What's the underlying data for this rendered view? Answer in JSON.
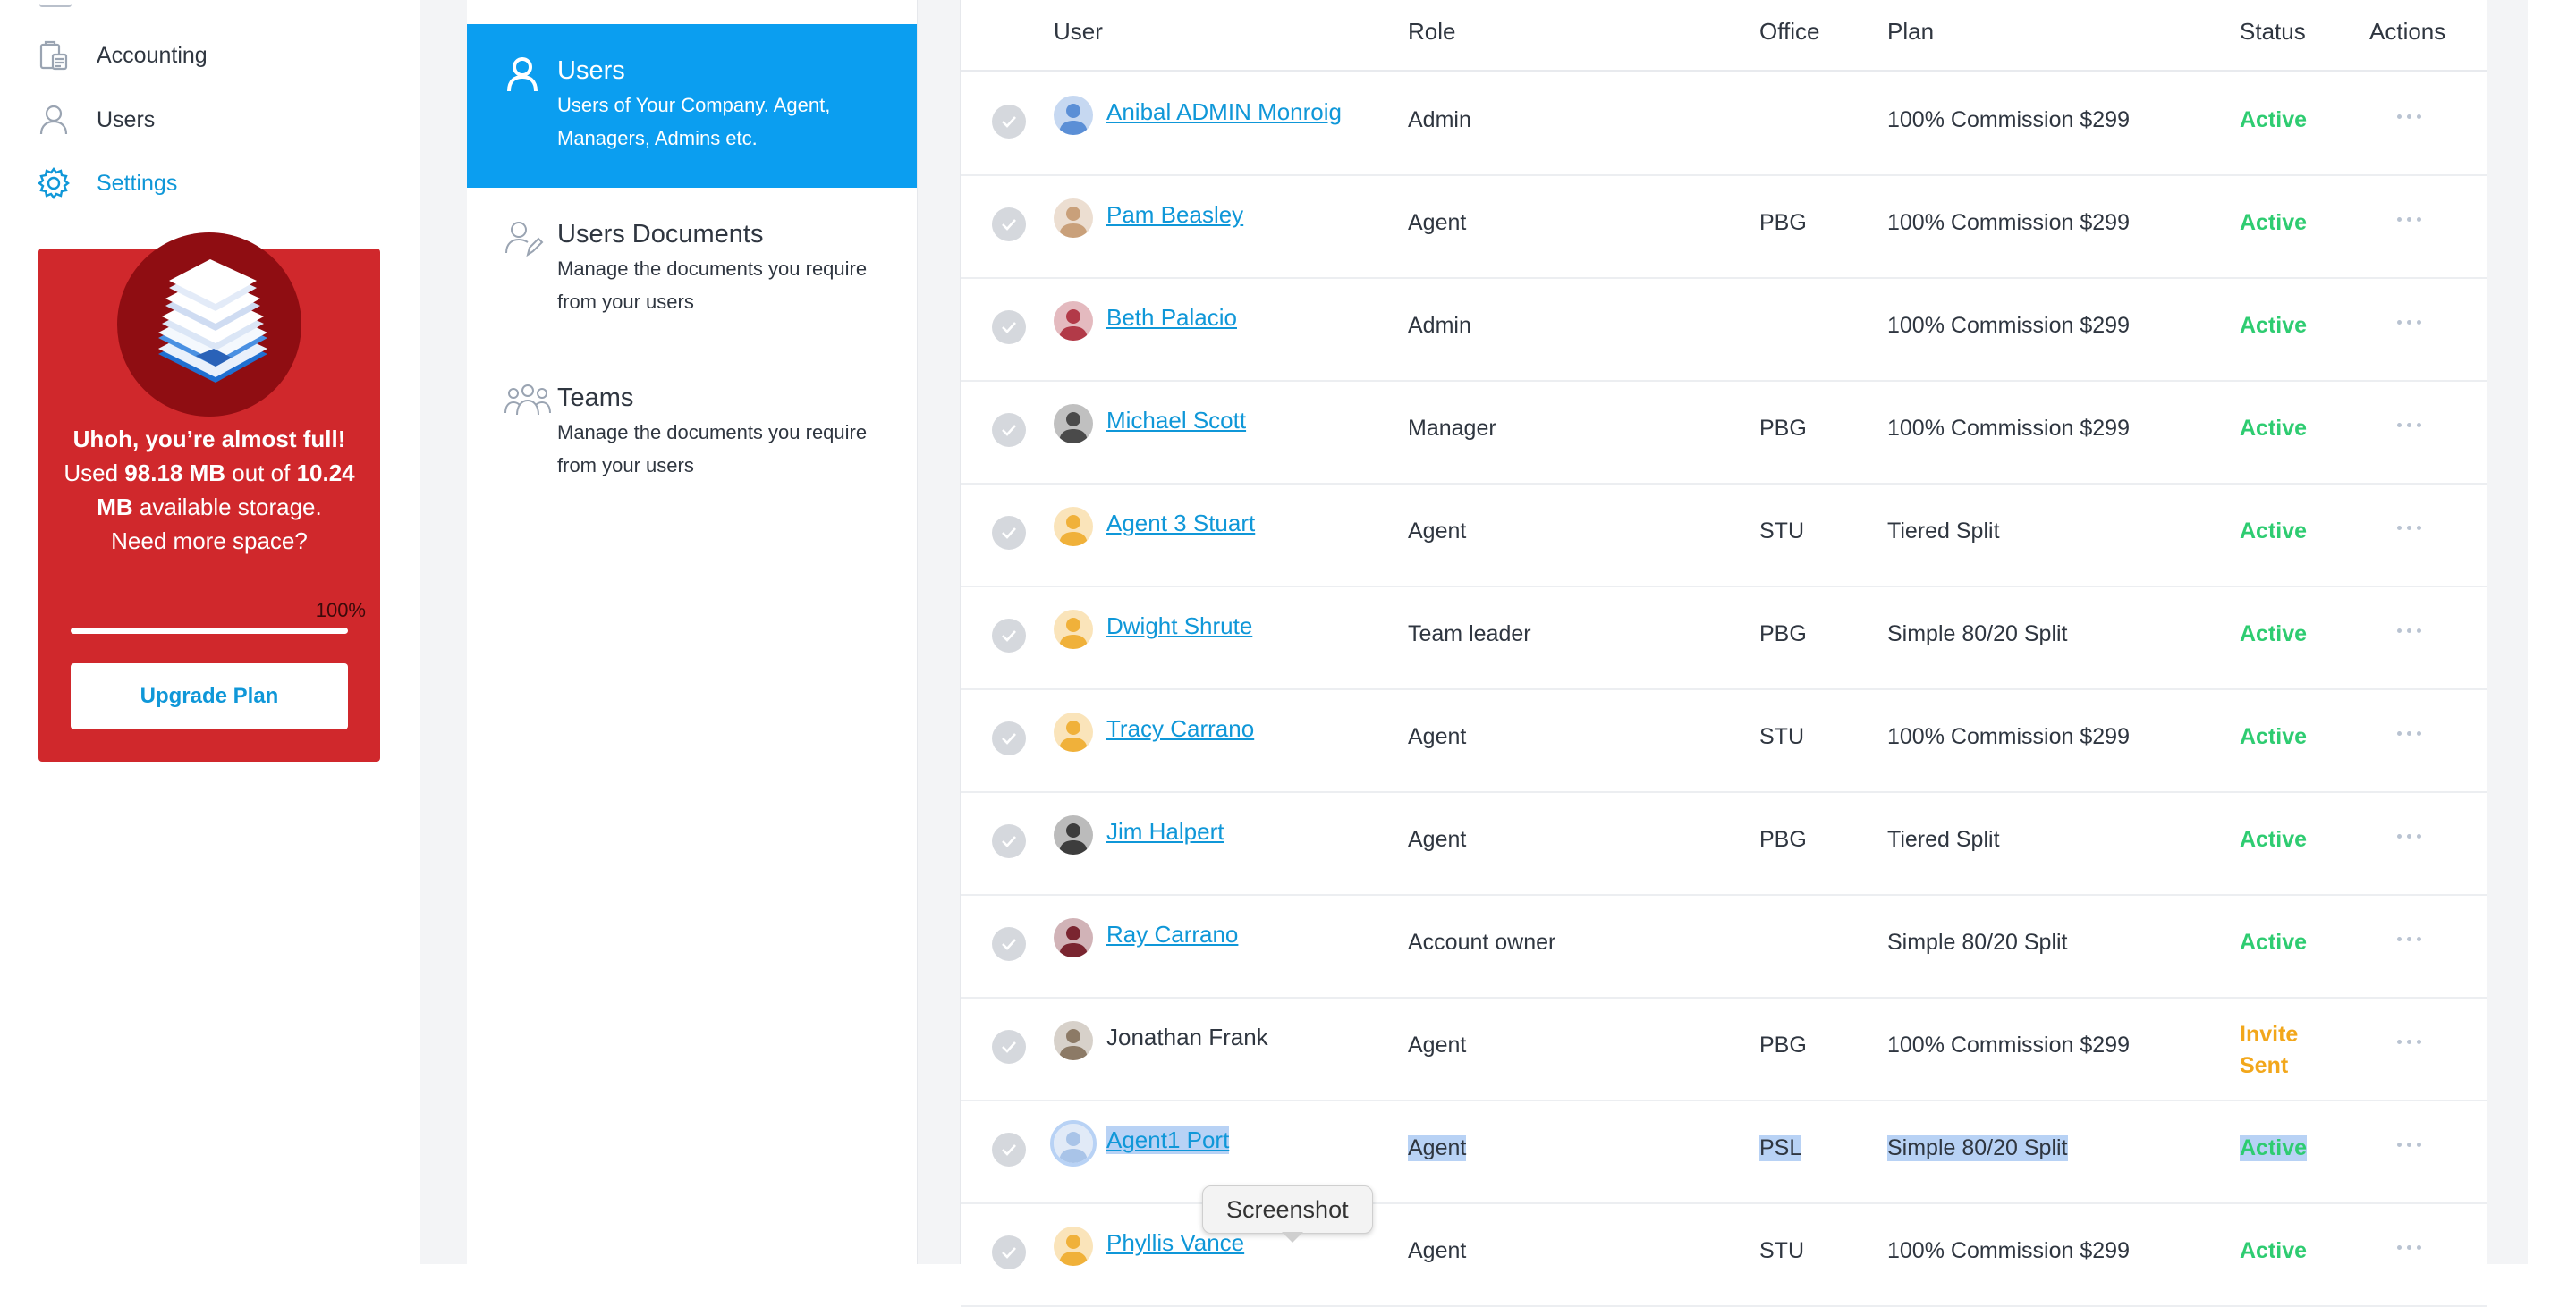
{
  "sidebar": {
    "items": [
      {
        "label": "Accounting",
        "icon": "accounting-icon",
        "active": false
      },
      {
        "label": "Users",
        "icon": "user-icon",
        "active": false
      },
      {
        "label": "Settings",
        "icon": "gear-icon",
        "active": true
      }
    ],
    "storage": {
      "headline": "Uhoh, you’re almost full!",
      "used_prefix": "Used",
      "used_value": "98.18 MB",
      "used_mid": "out of",
      "limit_value": "10.24 MB",
      "limit_suffix": "available storage.",
      "question": "Need more space?",
      "percent_label": "100%",
      "percent_value": 100,
      "button_label": "Upgrade Plan"
    }
  },
  "settings_menu": [
    {
      "title": "Users",
      "description": "Users of Your Company. Agent, Managers, Admins etc.",
      "icon": "user-icon",
      "active": true
    },
    {
      "title": "Users Documents",
      "description": "Manage the documents you require from your users",
      "icon": "user-document-icon",
      "active": false
    },
    {
      "title": "Teams",
      "description": "Manage the documents you require from your users",
      "icon": "team-icon",
      "active": false
    }
  ],
  "table": {
    "headers": {
      "user": "User",
      "role": "Role",
      "office": "Office",
      "plan": "Plan",
      "status": "Status",
      "actions": "Actions"
    },
    "rows": [
      {
        "name": "Anibal ADMIN Monroig",
        "role": "Admin",
        "office": "",
        "plan": "100% Commission $299",
        "status": "Active",
        "linked": true
      },
      {
        "name": "Pam Beasley",
        "role": "Agent",
        "office": "PBG",
        "plan": "100% Commission $299",
        "status": "Active",
        "linked": true
      },
      {
        "name": "Beth Palacio",
        "role": "Admin",
        "office": "",
        "plan": "100% Commission $299",
        "status": "Active",
        "linked": true
      },
      {
        "name": "Michael Scott",
        "role": "Manager",
        "office": "PBG",
        "plan": "100% Commission $299",
        "status": "Active",
        "linked": true
      },
      {
        "name": "Agent 3 Stuart",
        "role": "Agent",
        "office": "STU",
        "plan": "Tiered Split",
        "status": "Active",
        "linked": true
      },
      {
        "name": "Dwight Shrute",
        "role": "Team leader",
        "office": "PBG",
        "plan": "Simple 80/20 Split",
        "status": "Active",
        "linked": true
      },
      {
        "name": "Tracy Carrano",
        "role": "Agent",
        "office": "STU",
        "plan": "100% Commission $299",
        "status": "Active",
        "linked": true
      },
      {
        "name": "Jim Halpert",
        "role": "Agent",
        "office": "PBG",
        "plan": "Tiered Split",
        "status": "Active",
        "linked": true
      },
      {
        "name": "Ray Carrano",
        "role": "Account owner",
        "office": "",
        "plan": "Simple 80/20 Split",
        "status": "Active",
        "linked": true
      },
      {
        "name": "Jonathan Frank",
        "role": "Agent",
        "office": "PBG",
        "plan": "100% Commission $299",
        "status": "Invite Sent",
        "linked": false
      },
      {
        "name": "Agent1 Port",
        "role": "Agent",
        "office": "PSL",
        "plan": "Simple 80/20 Split",
        "status": "Active",
        "linked": true,
        "selected": true
      },
      {
        "name": "Phyllis Vance",
        "role": "Agent",
        "office": "STU",
        "plan": "100% Commission $299",
        "status": "Active",
        "linked": true
      }
    ]
  },
  "tooltip": {
    "text": "Screenshot"
  },
  "colors": {
    "accent": "#0f97d8",
    "active_menu": "#0b9ef0",
    "storage_card": "#d0282c",
    "status_active": "#2ecc71",
    "status_invite": "#f2a71b",
    "selection": "#b8d2f5"
  }
}
